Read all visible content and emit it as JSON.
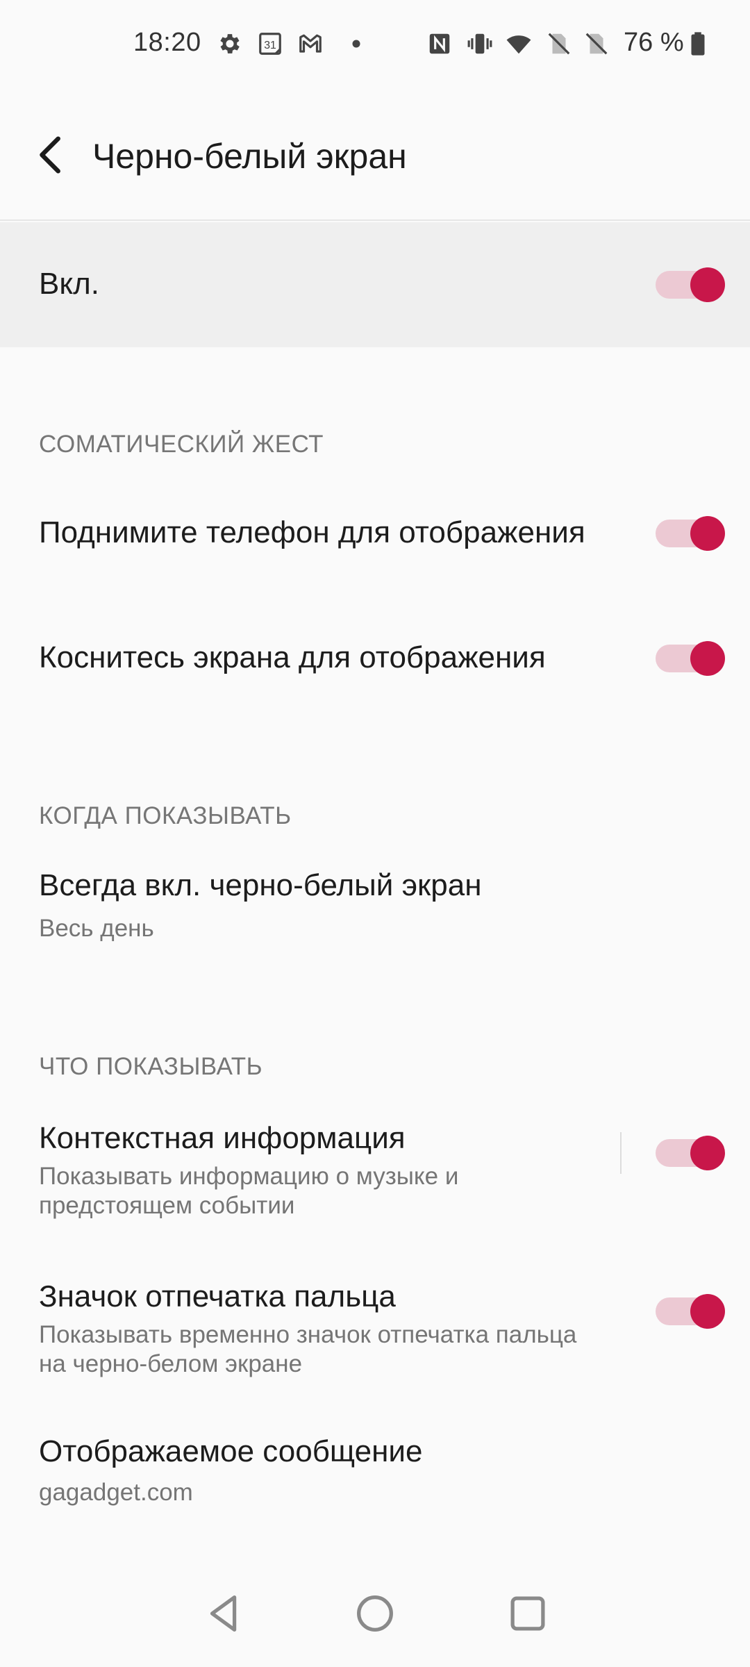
{
  "status_bar": {
    "time": "18:20",
    "calendar_day": "31",
    "battery_percent": "76 %",
    "icons": [
      "gear-icon",
      "calendar-icon",
      "gmail-icon",
      "dot-icon",
      "nfc-icon",
      "vibrate-icon",
      "wifi-icon",
      "no-sim-icon",
      "no-sim-icon",
      "battery-icon"
    ]
  },
  "header": {
    "title": "Черно-белый экран",
    "back_icon": "back-arrow-icon"
  },
  "master_toggle": {
    "label": "Вкл.",
    "enabled": true
  },
  "sections": {
    "gesture": {
      "header": "СОМАТИЧЕСКИЙ ЖЕСТ",
      "items": [
        {
          "title": "Поднимите телефон для отображения",
          "enabled": true
        },
        {
          "title": "Коснитесь экрана для отображения",
          "enabled": true
        }
      ]
    },
    "when": {
      "header": "КОГДА ПОКАЗЫВАТЬ",
      "items": [
        {
          "title": "Всегда вкл. черно-белый экран",
          "summary": "Весь день"
        }
      ]
    },
    "what": {
      "header": "ЧТО ПОКАЗЫВАТЬ",
      "items": [
        {
          "title": "Контекстная информация",
          "summary_line1": "Показывать информацию о музыке и",
          "summary_line2": "предстоящем событии",
          "enabled": true
        },
        {
          "title": "Значок отпечатка пальца",
          "summary_line1": "Показывать временно значок отпечатка пальца",
          "summary_line2": "на черно-белом экране",
          "enabled": true
        },
        {
          "title": "Отображаемое сообщение",
          "summary": "gagadget.com"
        }
      ]
    }
  },
  "nav_bar": {
    "icons": [
      "nav-back-icon",
      "nav-home-icon",
      "nav-recents-icon"
    ]
  },
  "colors": {
    "accent": "#c8174a",
    "track": "#ecc9d3",
    "background": "#fafafa",
    "highlight_row": "#efefef"
  }
}
